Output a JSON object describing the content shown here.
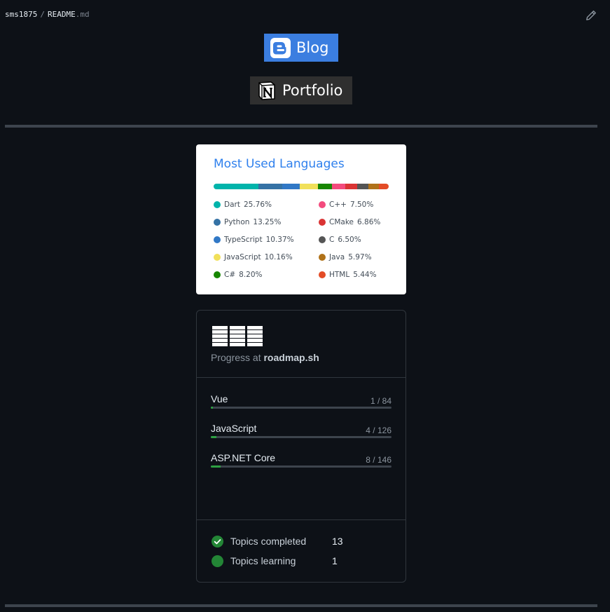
{
  "breadcrumb": {
    "owner": "sms1875",
    "separator": "/",
    "file_name": "README",
    "file_ext": ".md"
  },
  "header": {
    "edit_icon": "pencil-icon"
  },
  "badges": [
    {
      "label": "Blog",
      "icon": "blogger-icon",
      "color": "#3b7ee0"
    },
    {
      "label": "Portfolio",
      "icon": "notion-icon",
      "color": "#2f2f2f"
    }
  ],
  "languages_card": {
    "title": "Most Used Languages",
    "items": [
      {
        "name": "Dart",
        "percent": "25.76%",
        "value": 25.76,
        "color": "#00B4AB"
      },
      {
        "name": "Python",
        "percent": "13.25%",
        "value": 13.25,
        "color": "#3572A5"
      },
      {
        "name": "TypeScript",
        "percent": "10.37%",
        "value": 10.37,
        "color": "#3178C6"
      },
      {
        "name": "JavaScript",
        "percent": "10.16%",
        "value": 10.16,
        "color": "#F1E05A"
      },
      {
        "name": "C#",
        "percent": "8.20%",
        "value": 8.2,
        "color": "#178600"
      },
      {
        "name": "C++",
        "percent": "7.50%",
        "value": 7.5,
        "color": "#F34B7D"
      },
      {
        "name": "CMake",
        "percent": "6.86%",
        "value": 6.86,
        "color": "#DA3434"
      },
      {
        "name": "C",
        "percent": "6.50%",
        "value": 6.5,
        "color": "#555555"
      },
      {
        "name": "Java",
        "percent": "5.97%",
        "value": 5.97,
        "color": "#B07219"
      },
      {
        "name": "HTML",
        "percent": "5.44%",
        "value": 5.44,
        "color": "#E34C26"
      }
    ]
  },
  "roadmap_card": {
    "logo_icon": "roadmap-logo-icon",
    "subtitle_prefix": "Progress at",
    "subtitle_site": "roadmap.sh",
    "roadmaps": [
      {
        "name": "Vue",
        "count": "1 / 84",
        "progress": 0.0119
      },
      {
        "name": "JavaScript",
        "count": "4 / 126",
        "progress": 0.0317
      },
      {
        "name": "ASP.NET Core",
        "count": "8 / 146",
        "progress": 0.0548
      }
    ],
    "stats": [
      {
        "label": "Topics completed",
        "value": "13",
        "icon": "check-circle-icon"
      },
      {
        "label": "Topics learning",
        "value": "1",
        "icon": "filled-circle-icon"
      }
    ],
    "accent_color": "#2ea043"
  }
}
